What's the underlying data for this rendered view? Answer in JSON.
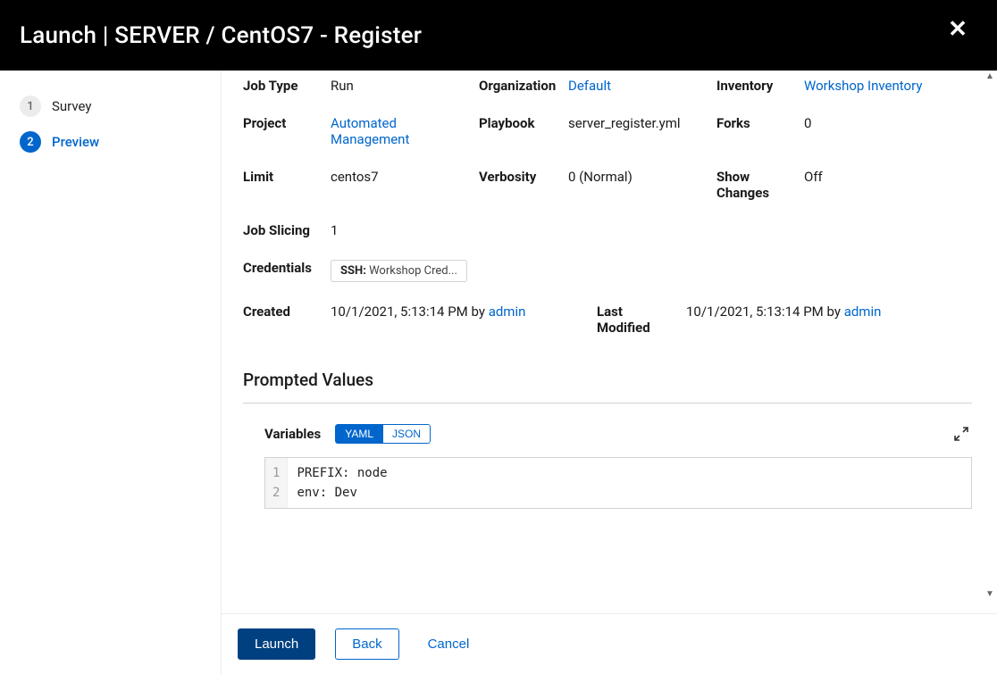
{
  "header": {
    "title": "Launch | SERVER / CentOS7 - Register"
  },
  "wizard": {
    "steps": [
      {
        "num": "1",
        "label": "Survey"
      },
      {
        "num": "2",
        "label": "Preview"
      }
    ]
  },
  "details": {
    "job_type_label": "Job Type",
    "job_type": "Run",
    "organization_label": "Organization",
    "organization": "Default",
    "inventory_label": "Inventory",
    "inventory": "Workshop Inventory",
    "project_label": "Project",
    "project": "Automated Management",
    "playbook_label": "Playbook",
    "playbook": "server_register.yml",
    "forks_label": "Forks",
    "forks": "0",
    "limit_label": "Limit",
    "limit": "centos7",
    "verbosity_label": "Verbosity",
    "verbosity": "0 (Normal)",
    "show_changes_label": "Show Changes",
    "show_changes": "Off",
    "job_slicing_label": "Job Slicing",
    "job_slicing": "1",
    "credentials_label": "Credentials",
    "cred_type": "SSH:",
    "cred_value": "Workshop Cred...",
    "created_label": "Created",
    "created_ts": "10/1/2021, 5:13:14 PM",
    "created_by_word": "by",
    "created_by": "admin",
    "modified_label": "Last Modified",
    "modified_ts": "10/1/2021, 5:13:14 PM",
    "modified_by_word": "by",
    "modified_by": "admin"
  },
  "prompted": {
    "heading": "Prompted Values"
  },
  "variables": {
    "label": "Variables",
    "yaml_btn": "YAML",
    "json_btn": "JSON",
    "lines": [
      "PREFIX: node",
      "env: Dev"
    ]
  },
  "footer": {
    "launch": "Launch",
    "back": "Back",
    "cancel": "Cancel"
  }
}
